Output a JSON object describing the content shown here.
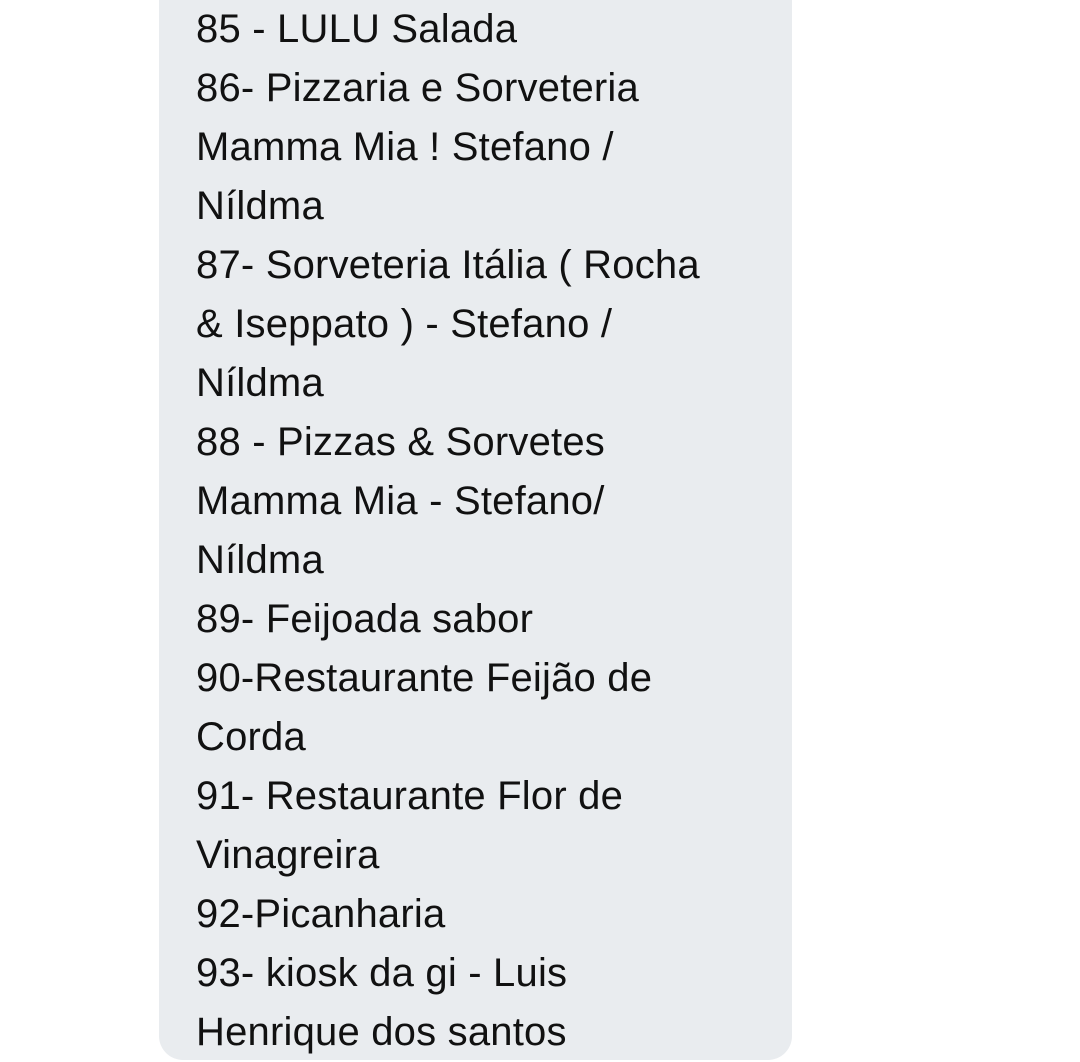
{
  "message": {
    "lines": [
      "85 - LULU Salada",
      "86- Pizzaria e Sorveteria",
      "Mamma Mia ! Stefano /",
      "Níldma",
      "87- Sorveteria Itália ( Rocha",
      "& Iseppato ) - Stefano /",
      "Níldma",
      "88 - Pizzas & Sorvetes",
      "Mamma Mia - Stefano/",
      "Níldma",
      "89- Feijoada sabor",
      "90-Restaurante Feijão de",
      "Corda",
      "91- Restaurante Flor de",
      "Vinagreira",
      "92-Picanharia",
      "93- kiosk da gi - Luis",
      "Henrique dos santos"
    ],
    "bubble_color": "#e9ecef",
    "text_color": "#111111"
  }
}
